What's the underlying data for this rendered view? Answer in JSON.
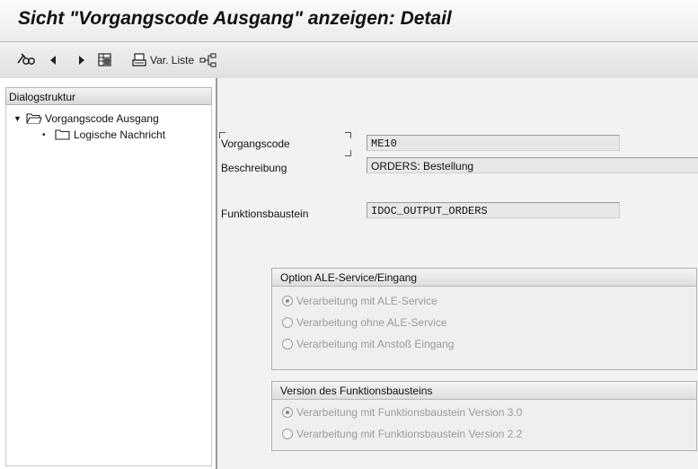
{
  "title": "Sicht \"Vorgangscode Ausgang\" anzeigen: Detail",
  "toolbar": {
    "var_liste_label": "Var. Liste"
  },
  "sidebar": {
    "header": "Dialogstruktur",
    "items": [
      {
        "label": "Vorgangscode Ausgang",
        "expanded": true,
        "icon": "folder-open-icon"
      },
      {
        "label": "Logische Nachricht",
        "icon": "folder-icon"
      }
    ]
  },
  "form": {
    "vorgangscode": {
      "label": "Vorgangscode",
      "value": "ME10"
    },
    "beschreibung": {
      "label": "Beschreibung",
      "value": "ORDERS: Bestellung"
    },
    "funktionsbaustein": {
      "label": "Funktionsbaustein",
      "value": "IDOC_OUTPUT_ORDERS"
    }
  },
  "option_group": {
    "title": "Option ALE-Service/Eingang",
    "options": [
      {
        "label": "Verarbeitung mit ALE-Service",
        "selected": true
      },
      {
        "label": "Verarbeitung ohne ALE-Service",
        "selected": false
      },
      {
        "label": "Verarbeitung mit Anstoß Eingang",
        "selected": false
      }
    ]
  },
  "version_group": {
    "title": "Version des Funktionsbausteins",
    "options": [
      {
        "label": "Verarbeitung mit Funktionsbaustein Version 3.0",
        "selected": true
      },
      {
        "label": "Verarbeitung mit Funktionsbaustein Version 2.2",
        "selected": false
      }
    ]
  },
  "colors": {
    "background": "#f2f2f2",
    "disabled_text": "#9b9b9b",
    "field_bg": "#e7e7e7"
  }
}
